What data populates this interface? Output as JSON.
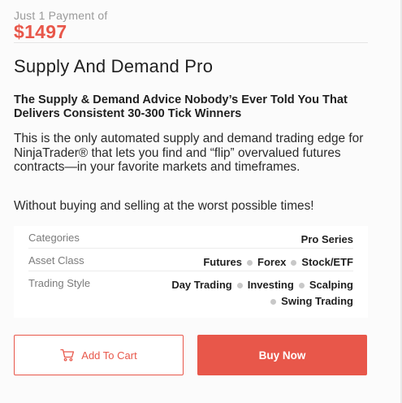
{
  "pricing": {
    "label": "Just 1 Payment of",
    "amount": "$1497"
  },
  "product": {
    "title": "Supply And Demand Pro",
    "headline": "The Supply & Demand Advice Nobody’s Ever Told You That Delivers Consistent 30-300 Tick Winners",
    "description": "This is the only automated supply and demand trading edge for NinjaTrader® that lets you find and “flip” overvalued futures contracts—in your favorite markets and timeframes.",
    "tagline": "Without buying and selling at the worst possible times!"
  },
  "details": {
    "categories": {
      "label": "Categories",
      "values": [
        "Pro Series"
      ]
    },
    "asset_class": {
      "label": "Asset Class",
      "values": [
        "Futures",
        "Forex",
        "Stock/ETF"
      ]
    },
    "trading_style": {
      "label": "Trading Style",
      "values": [
        "Day Trading",
        "Investing",
        "Scalping",
        "Swing Trading"
      ]
    }
  },
  "actions": {
    "add_to_cart_label": "Add To Cart",
    "buy_now_label": "Buy Now",
    "cart_icon": "cart-icon"
  },
  "colors": {
    "accent": "#e8574a",
    "muted_text": "#9a9a9a",
    "dot": "#c8c8c8"
  }
}
